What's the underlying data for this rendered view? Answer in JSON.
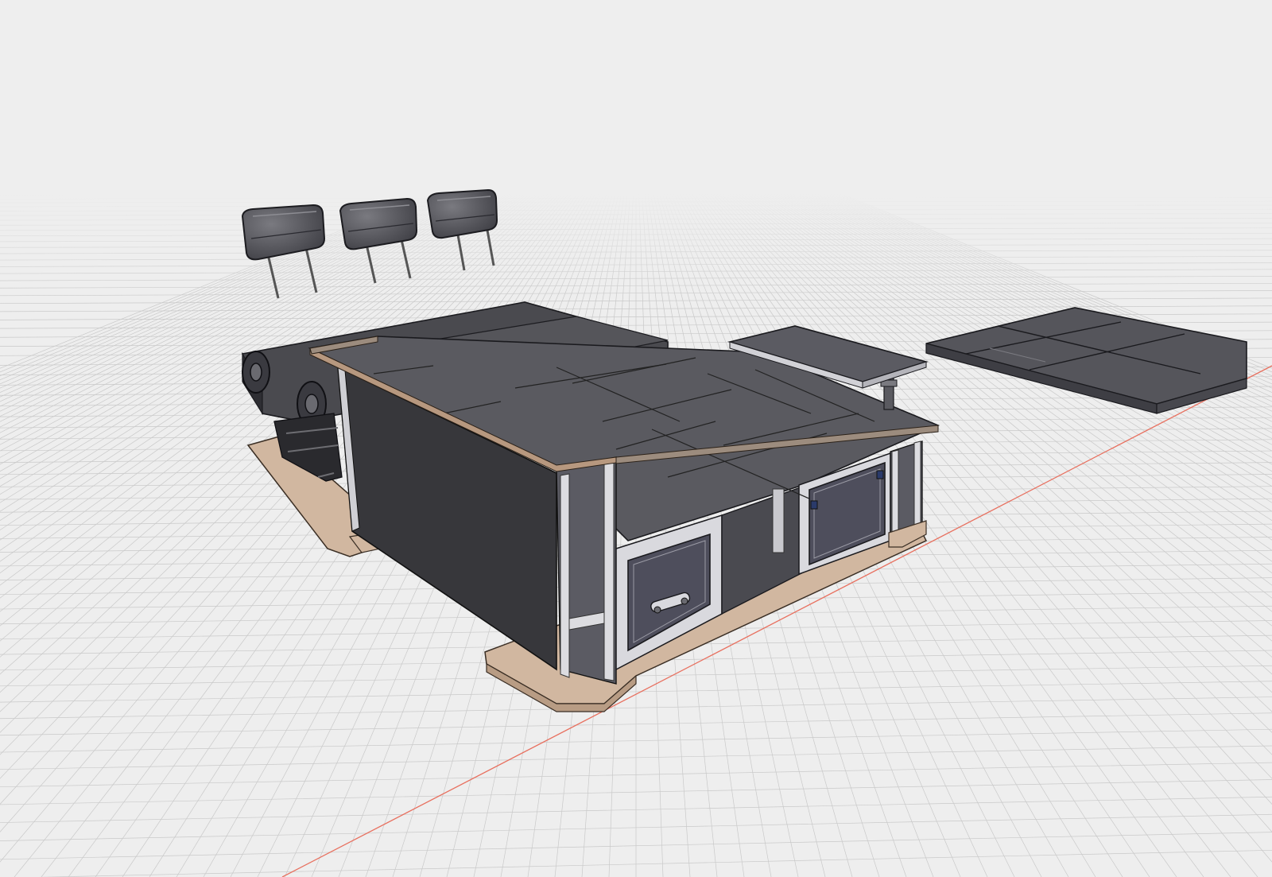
{
  "viewport": {
    "mode": "3d-cad-viewport",
    "background_color": "#eeeeee",
    "grid_color": "#c9c9c9",
    "axis_color": "#e8705f"
  },
  "model": {
    "material_colors": {
      "panel_dark": "#3a3a3e",
      "panel_top": "#5b5b60",
      "panel_light": "#6a6a70",
      "frame_aluminium": "#d6d6da",
      "plywood_base": "#d1b7a0",
      "drawer_front": "#4e4e5c"
    },
    "parts": [
      "headrest-left",
      "headrest-middle",
      "headrest-right",
      "rear-bench-seat",
      "storage-cabinet-frame",
      "drawer-front-left",
      "drawer-front-right",
      "base-floor-plate",
      "table-top",
      "table-leg",
      "mattress-cushion-panels"
    ]
  }
}
